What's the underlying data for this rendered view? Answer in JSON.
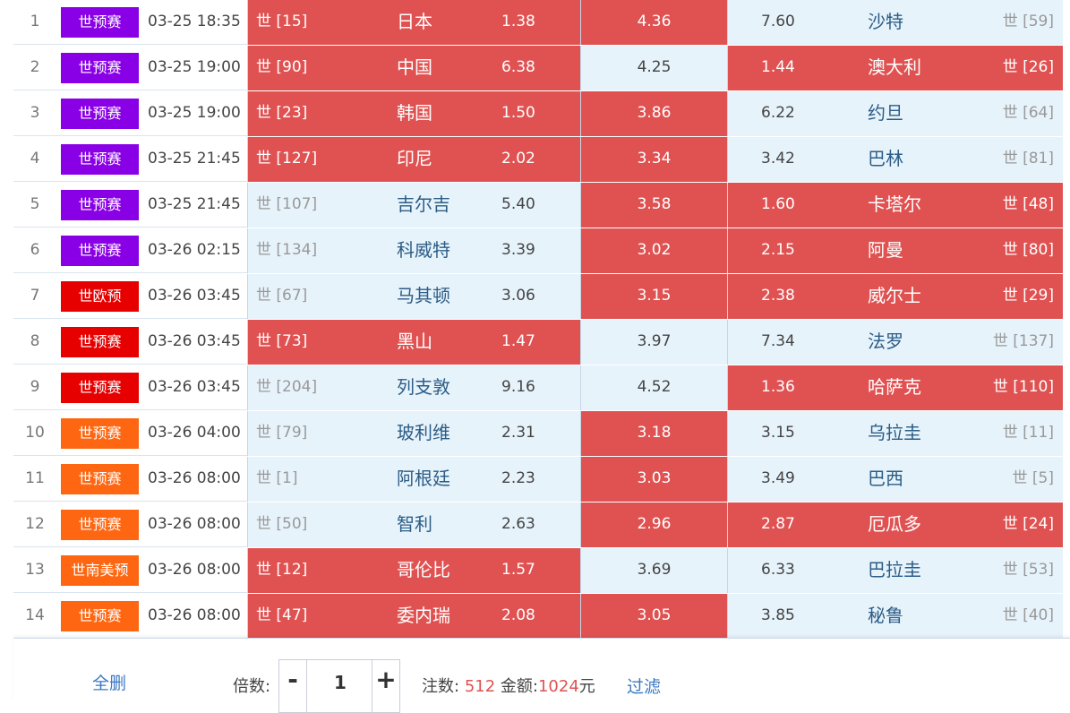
{
  "matches": [
    {
      "no": "1",
      "league": "世预赛",
      "league_color": "#8a00e6",
      "time": "03-25 18:35",
      "home_rank": "世 [15]",
      "home": "日本",
      "home_odds": "1.38",
      "draw_odds": "4.36",
      "away_odds": "7.60",
      "away": "沙特",
      "away_rank": "世 [59]",
      "home_hl": true,
      "draw_hl": true,
      "away_hl": false
    },
    {
      "no": "2",
      "league": "世预赛",
      "league_color": "#8a00e6",
      "time": "03-25 19:00",
      "home_rank": "世 [90]",
      "home": "中国",
      "home_odds": "6.38",
      "draw_odds": "4.25",
      "away_odds": "1.44",
      "away": "澳大利",
      "away_rank": "世 [26]",
      "home_hl": true,
      "draw_hl": false,
      "away_hl": true
    },
    {
      "no": "3",
      "league": "世预赛",
      "league_color": "#8a00e6",
      "time": "03-25 19:00",
      "home_rank": "世 [23]",
      "home": "韩国",
      "home_odds": "1.50",
      "draw_odds": "3.86",
      "away_odds": "6.22",
      "away": "约旦",
      "away_rank": "世 [64]",
      "home_hl": true,
      "draw_hl": true,
      "away_hl": false
    },
    {
      "no": "4",
      "league": "世预赛",
      "league_color": "#8a00e6",
      "time": "03-25 21:45",
      "home_rank": "世 [127]",
      "home": "印尼",
      "home_odds": "2.02",
      "draw_odds": "3.34",
      "away_odds": "3.42",
      "away": "巴林",
      "away_rank": "世 [81]",
      "home_hl": true,
      "draw_hl": true,
      "away_hl": false
    },
    {
      "no": "5",
      "league": "世预赛",
      "league_color": "#8a00e6",
      "time": "03-25 21:45",
      "home_rank": "世 [107]",
      "home": "吉尔吉",
      "home_odds": "5.40",
      "draw_odds": "3.58",
      "away_odds": "1.60",
      "away": "卡塔尔",
      "away_rank": "世 [48]",
      "home_hl": false,
      "draw_hl": true,
      "away_hl": true
    },
    {
      "no": "6",
      "league": "世预赛",
      "league_color": "#8a00e6",
      "time": "03-26 02:15",
      "home_rank": "世 [134]",
      "home": "科威特",
      "home_odds": "3.39",
      "draw_odds": "3.02",
      "away_odds": "2.15",
      "away": "阿曼",
      "away_rank": "世 [80]",
      "home_hl": false,
      "draw_hl": true,
      "away_hl": true
    },
    {
      "no": "7",
      "league": "世欧预",
      "league_color": "#e60000",
      "time": "03-26 03:45",
      "home_rank": "世 [67]",
      "home": "马其顿",
      "home_odds": "3.06",
      "draw_odds": "3.15",
      "away_odds": "2.38",
      "away": "威尔士",
      "away_rank": "世 [29]",
      "home_hl": false,
      "draw_hl": true,
      "away_hl": true
    },
    {
      "no": "8",
      "league": "世预赛",
      "league_color": "#e60000",
      "time": "03-26 03:45",
      "home_rank": "世 [73]",
      "home": "黑山",
      "home_odds": "1.47",
      "draw_odds": "3.97",
      "away_odds": "7.34",
      "away": "法罗",
      "away_rank": "世 [137]",
      "home_hl": true,
      "draw_hl": false,
      "away_hl": false
    },
    {
      "no": "9",
      "league": "世预赛",
      "league_color": "#e60000",
      "time": "03-26 03:45",
      "home_rank": "世 [204]",
      "home": "列支敦",
      "home_odds": "9.16",
      "draw_odds": "4.52",
      "away_odds": "1.36",
      "away": "哈萨克",
      "away_rank": "世 [110]",
      "home_hl": false,
      "draw_hl": false,
      "away_hl": true
    },
    {
      "no": "10",
      "league": "世预赛",
      "league_color": "#ff6611",
      "time": "03-26 04:00",
      "home_rank": "世 [79]",
      "home": "玻利维",
      "home_odds": "2.31",
      "draw_odds": "3.18",
      "away_odds": "3.15",
      "away": "乌拉圭",
      "away_rank": "世 [11]",
      "home_hl": false,
      "draw_hl": true,
      "away_hl": false
    },
    {
      "no": "11",
      "league": "世预赛",
      "league_color": "#ff6611",
      "time": "03-26 08:00",
      "home_rank": "世 [1]",
      "home": "阿根廷",
      "home_odds": "2.23",
      "draw_odds": "3.03",
      "away_odds": "3.49",
      "away": "巴西",
      "away_rank": "世 [5]",
      "home_hl": false,
      "draw_hl": true,
      "away_hl": false
    },
    {
      "no": "12",
      "league": "世预赛",
      "league_color": "#ff6611",
      "time": "03-26 08:00",
      "home_rank": "世 [50]",
      "home": "智利",
      "home_odds": "2.63",
      "draw_odds": "2.96",
      "away_odds": "2.87",
      "away": "厄瓜多",
      "away_rank": "世 [24]",
      "home_hl": false,
      "draw_hl": true,
      "away_hl": true
    },
    {
      "no": "13",
      "league": "世南美预",
      "league_color": "#ff6611",
      "time": "03-26 08:00",
      "home_rank": "世 [12]",
      "home": "哥伦比",
      "home_odds": "1.57",
      "draw_odds": "3.69",
      "away_odds": "6.33",
      "away": "巴拉圭",
      "away_rank": "世 [53]",
      "home_hl": true,
      "draw_hl": false,
      "away_hl": false
    },
    {
      "no": "14",
      "league": "世预赛",
      "league_color": "#ff6611",
      "time": "03-26 08:00",
      "home_rank": "世 [47]",
      "home": "委内瑞",
      "home_odds": "2.08",
      "draw_odds": "3.05",
      "away_odds": "3.85",
      "away": "秘鲁",
      "away_rank": "世 [40]",
      "home_hl": true,
      "draw_hl": true,
      "away_hl": false
    }
  ],
  "footer": {
    "clear_label": "全删",
    "multiplier_label": "倍数:",
    "minus": "-",
    "multiplier_value": "1",
    "plus": "+",
    "bets_label": "注数:",
    "bets_value": "512",
    "amount_label": "金额:",
    "amount_value": "1024",
    "amount_unit": "元",
    "filter_label": "过滤"
  }
}
